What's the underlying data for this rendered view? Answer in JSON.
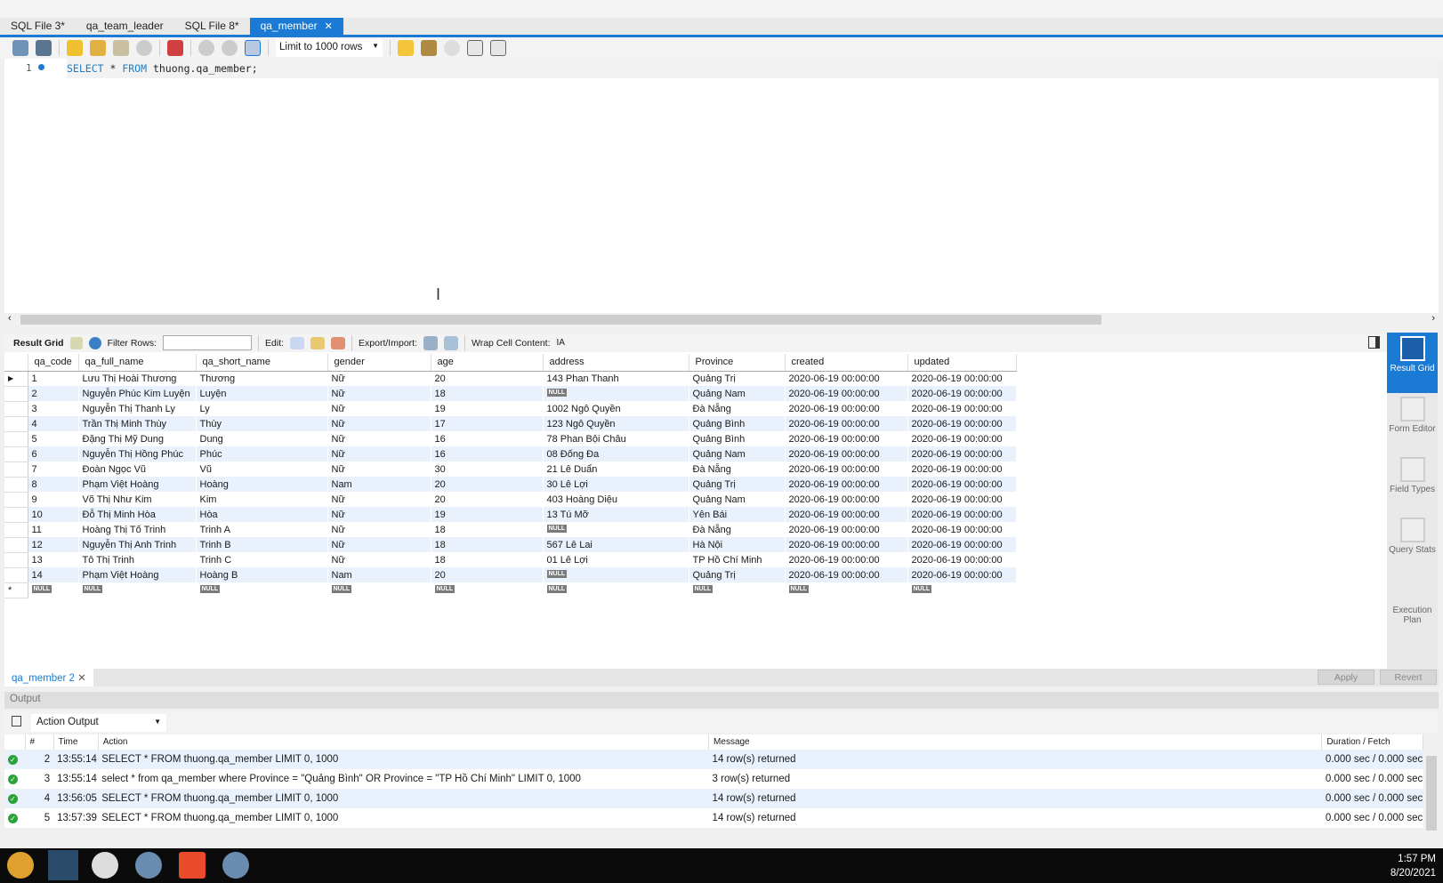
{
  "tabs": [
    {
      "label": "SQL File 3*"
    },
    {
      "label": "qa_team_leader"
    },
    {
      "label": "SQL File 8*"
    },
    {
      "label": "qa_member"
    }
  ],
  "toolbar": {
    "limit": "Limit to 1000 rows"
  },
  "editor": {
    "line": "1",
    "kw1": "SELECT",
    "star": " * ",
    "kw2": "FROM",
    "rest": " thuong.qa_member;"
  },
  "result_toolbar": {
    "result_grid": "Result Grid",
    "filter_rows": "Filter Rows:",
    "edit": "Edit:",
    "export_import": "Export/Import:",
    "wrap": "Wrap Cell Content:"
  },
  "grid": {
    "columns": [
      "qa_code",
      "qa_full_name",
      "qa_short_name",
      "gender",
      "age",
      "address",
      "Province",
      "created",
      "updated"
    ],
    "null_label": "NULL",
    "new_row_marker": "*",
    "rows": [
      [
        "1",
        "Lưu Thị Hoài Thương",
        "Thương",
        "Nữ",
        "20",
        "143 Phan Thanh",
        "Quảng Trị",
        "2020-06-19 00:00:00",
        "2020-06-19 00:00:00"
      ],
      [
        "2",
        "Nguyễn Phúc Kim Luyện",
        "Luyện",
        "Nữ",
        "18",
        null,
        "Quảng Nam",
        "2020-06-19 00:00:00",
        "2020-06-19 00:00:00"
      ],
      [
        "3",
        "Nguyễn Thị Thanh Ly",
        "Ly",
        "Nữ",
        "19",
        "1002 Ngô Quyền",
        "Đà Nẵng",
        "2020-06-19 00:00:00",
        "2020-06-19 00:00:00"
      ],
      [
        "4",
        "Trần Thị Minh Thùy",
        "Thùy",
        "Nữ",
        "17",
        "123  Ngô Quyền",
        "Quảng Bình",
        "2020-06-19 00:00:00",
        "2020-06-19 00:00:00"
      ],
      [
        "5",
        "Đặng Thị Mỹ Dung",
        "Dung",
        "Nữ",
        "16",
        "78 Phan  Bội Châu",
        "Quảng Bình",
        "2020-06-19 00:00:00",
        "2020-06-19 00:00:00"
      ],
      [
        "6",
        "Nguyễn Thị Hồng Phúc",
        "Phúc",
        "Nữ",
        "16",
        "08 Đống Đa",
        "Quảng Nam",
        "2020-06-19 00:00:00",
        "2020-06-19 00:00:00"
      ],
      [
        "7",
        "Đoàn Ngọc Vũ",
        "Vũ",
        "Nữ",
        "30",
        "21 Lê Duẩn",
        "Đà Nẵng",
        "2020-06-19 00:00:00",
        "2020-06-19 00:00:00"
      ],
      [
        "8",
        "Phạm Việt Hoàng",
        "Hoàng",
        "Nam",
        "20",
        "30 Lê Lợi",
        "Quảng Trị",
        "2020-06-19 00:00:00",
        "2020-06-19 00:00:00"
      ],
      [
        "9",
        "Võ Thị Như Kim",
        "Kim",
        "Nữ",
        "20",
        "403 Hoàng Diệu",
        "Quảng Nam",
        "2020-06-19 00:00:00",
        "2020-06-19 00:00:00"
      ],
      [
        "10",
        "Đỗ Thị Minh Hòa",
        "Hòa",
        "Nữ",
        "19",
        "13 Tú Mỡ",
        "Yên Bái",
        "2020-06-19 00:00:00",
        "2020-06-19 00:00:00"
      ],
      [
        "11",
        "Hoàng Thị Tố Trinh",
        "Trinh A",
        "Nữ",
        "18",
        null,
        "Đà Nẵng",
        "2020-06-19 00:00:00",
        "2020-06-19 00:00:00"
      ],
      [
        "12",
        "Nguyễn Thị Anh Trinh",
        "Trinh B",
        "Nữ",
        "18",
        "567 Lê Lai",
        "Hà Nội",
        "2020-06-19 00:00:00",
        "2020-06-19 00:00:00"
      ],
      [
        "13",
        "Tô Thị Trinh",
        "Trinh C",
        "Nữ",
        "18",
        "01 Lê Lợi",
        "TP Hồ Chí Minh",
        "2020-06-19 00:00:00",
        "2020-06-19 00:00:00"
      ],
      [
        "14",
        "Phạm Việt Hoàng",
        "Hoàng B",
        "Nam",
        "20",
        null,
        "Quảng Trị",
        "2020-06-19 00:00:00",
        "2020-06-19 00:00:00"
      ]
    ]
  },
  "side_panel": [
    {
      "label": "Result Grid"
    },
    {
      "label": "Form Editor"
    },
    {
      "label": "Field Types"
    },
    {
      "label": "Query Stats"
    },
    {
      "label": "Execution Plan"
    }
  ],
  "result_tab": "qa_member 2",
  "buttons": {
    "apply": "Apply",
    "revert": "Revert"
  },
  "output": {
    "title": "Output",
    "selector": "Action Output",
    "columns": [
      "#",
      "Time",
      "Action",
      "Message",
      "Duration / Fetch"
    ],
    "rows": [
      [
        "2",
        "13:55:14",
        "SELECT * FROM thuong.qa_member LIMIT 0, 1000",
        "14 row(s) returned",
        "0.000 sec / 0.000 sec"
      ],
      [
        "3",
        "13:55:14",
        "select * from qa_member where Province = \"Quảng Bình\" OR Province = \"TP Hồ Chí Minh\" LIMIT 0, 1000",
        "3 row(s) returned",
        "0.000 sec / 0.000 sec"
      ],
      [
        "4",
        "13:56:05",
        "SELECT * FROM thuong.qa_member LIMIT 0, 1000",
        "14 row(s) returned",
        "0.000 sec / 0.000 sec"
      ],
      [
        "5",
        "13:57:39",
        "SELECT * FROM thuong.qa_member LIMIT 0, 1000",
        "14 row(s) returned",
        "0.000 sec / 0.000 sec"
      ]
    ]
  },
  "clock": {
    "time": "1:57 PM",
    "date": "8/20/2021"
  }
}
